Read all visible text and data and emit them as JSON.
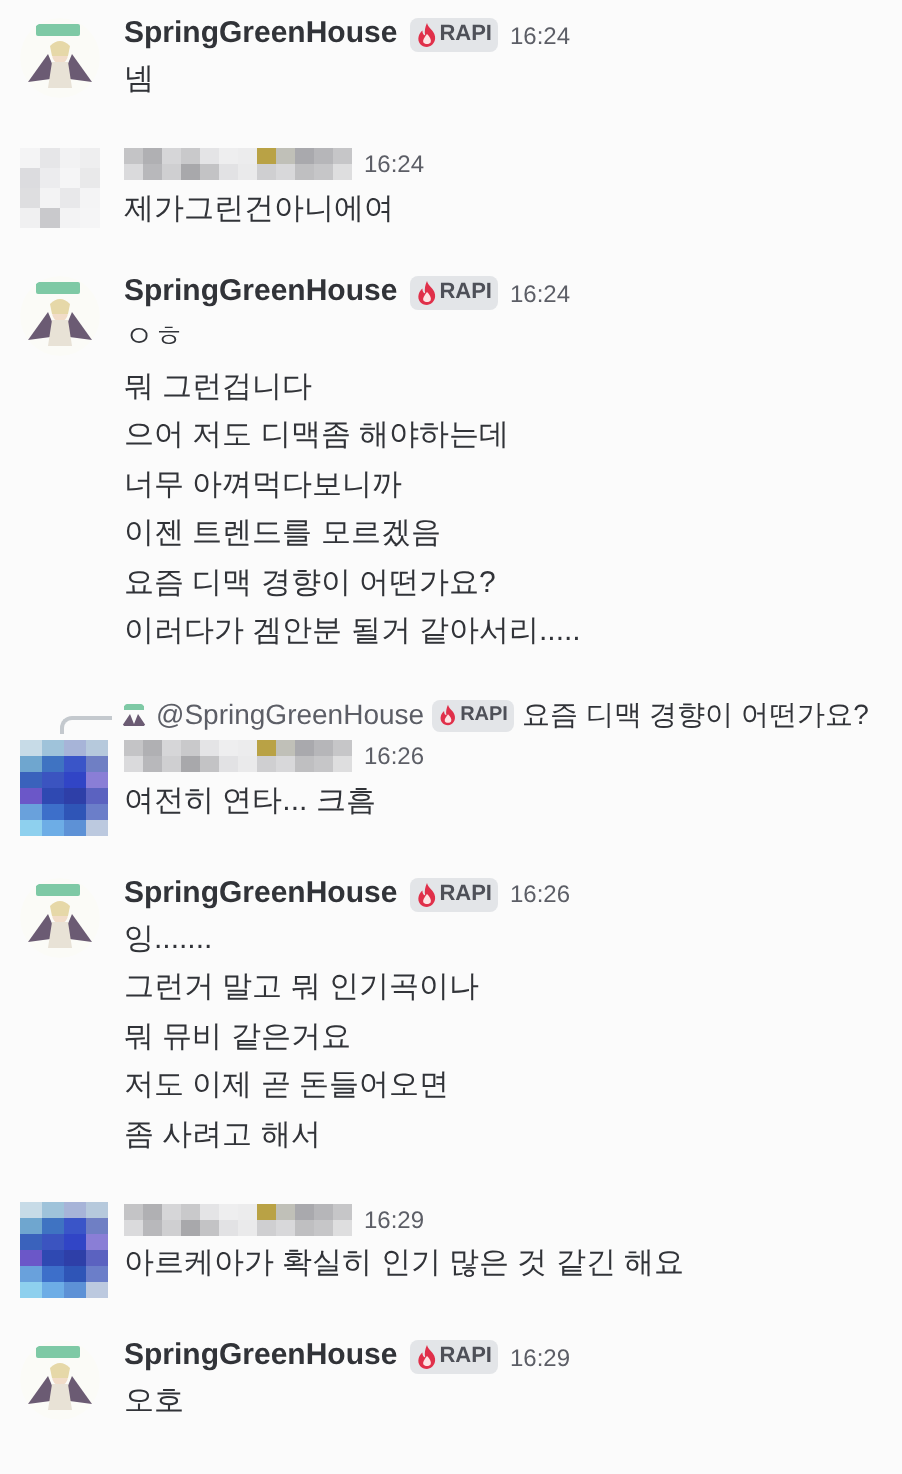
{
  "messages": [
    {
      "author": {
        "kind": "named",
        "name": "SpringGreenHouse",
        "badge": "RAPI"
      },
      "avatar": {
        "kind": "figure"
      },
      "time": "16:24",
      "lines": [
        "넴"
      ]
    },
    {
      "author": {
        "kind": "blurred"
      },
      "avatar": {
        "kind": "pixel-gray"
      },
      "time": "16:24",
      "lines": [
        "제가그린건아니에여"
      ]
    },
    {
      "author": {
        "kind": "named",
        "name": "SpringGreenHouse",
        "badge": "RAPI"
      },
      "avatar": {
        "kind": "figure"
      },
      "time": "16:24",
      "lines": [
        "ㅇㅎ",
        "뭐 그런겁니다",
        "으어 저도 디맥좀 해야하는데",
        "너무 아껴먹다보니까",
        "이젠 트렌드를 모르겠음",
        "요즘 디맥 경향이 어떤가요?",
        "이러다가 겜안분 될거 같아서리....."
      ]
    },
    {
      "reply": {
        "name": "@SpringGreenHouse",
        "badge": "RAPI",
        "text": "요즘 디맥 경향이 어떤가요?"
      },
      "author": {
        "kind": "blurred"
      },
      "avatar": {
        "kind": "pixel-blue"
      },
      "time": "16:26",
      "lines": [
        "여전히 연타... 크흠"
      ]
    },
    {
      "author": {
        "kind": "named",
        "name": "SpringGreenHouse",
        "badge": "RAPI"
      },
      "avatar": {
        "kind": "figure"
      },
      "time": "16:26",
      "lines": [
        "잉.......",
        "그런거 말고 뭐 인기곡이나",
        "뭐 뮤비 같은거요",
        "저도 이제 곧 돈들어오면",
        "좀 사려고 해서"
      ]
    },
    {
      "author": {
        "kind": "blurred"
      },
      "avatar": {
        "kind": "pixel-blue"
      },
      "time": "16:29",
      "lines": [
        "아르케아가 확실히 인기 많은 것 같긴 해요"
      ]
    },
    {
      "author": {
        "kind": "named",
        "name": "SpringGreenHouse",
        "badge": "RAPI"
      },
      "avatar": {
        "kind": "figure"
      },
      "time": "16:29",
      "lines": [
        "오호"
      ]
    }
  ]
}
